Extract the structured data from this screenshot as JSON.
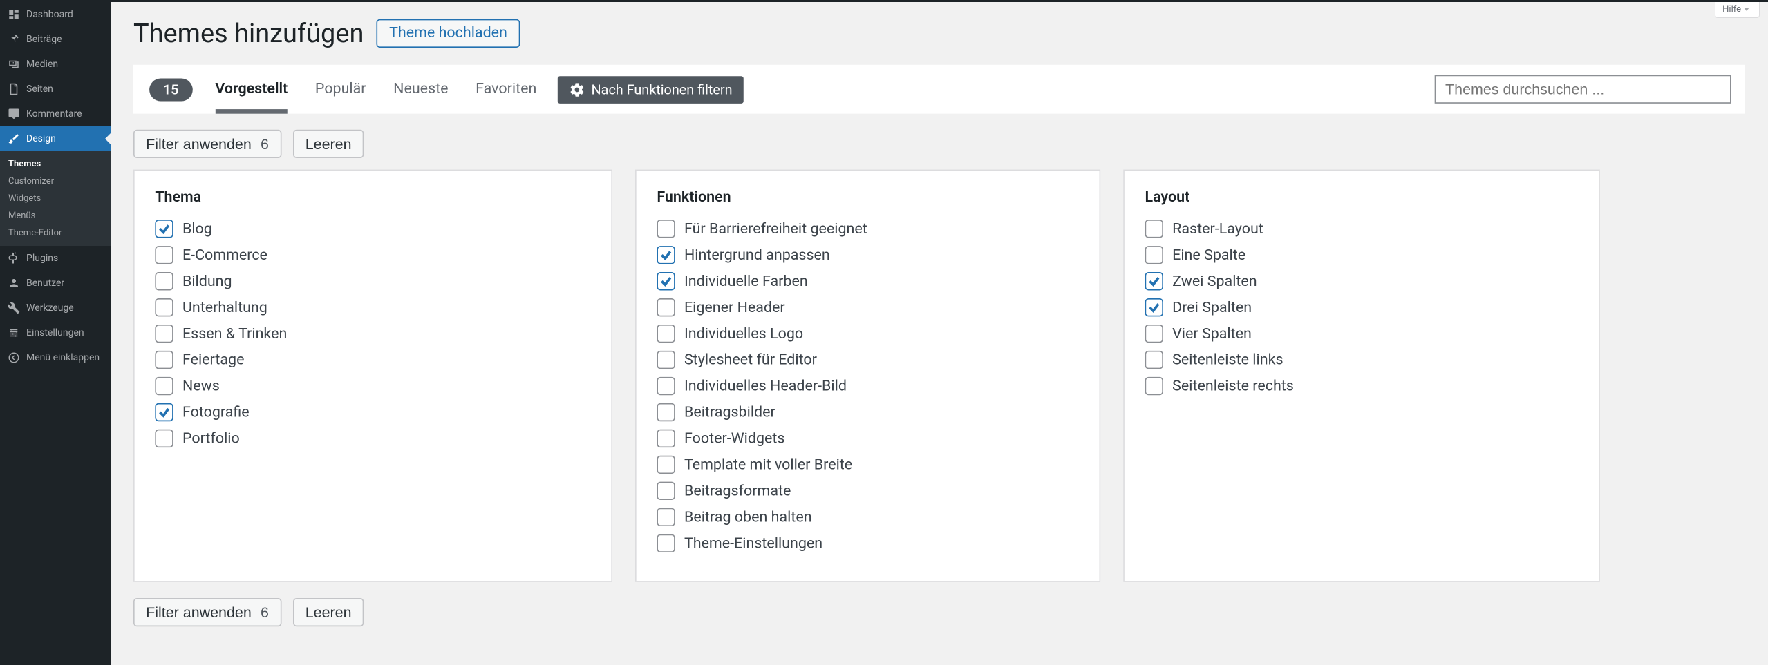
{
  "topHelp": "Hilfe",
  "sidebar": {
    "items": [
      {
        "label": "Dashboard",
        "icon": "dashboard"
      },
      {
        "label": "Beiträge",
        "icon": "pin"
      },
      {
        "label": "Medien",
        "icon": "media"
      },
      {
        "label": "Seiten",
        "icon": "page"
      },
      {
        "label": "Kommentare",
        "icon": "comment"
      },
      {
        "label": "Design",
        "icon": "brush",
        "active": true
      },
      {
        "label": "Plugins",
        "icon": "plugin"
      },
      {
        "label": "Benutzer",
        "icon": "user"
      },
      {
        "label": "Werkzeuge",
        "icon": "tool"
      },
      {
        "label": "Einstellungen",
        "icon": "settings"
      },
      {
        "label": "Menü einklappen",
        "icon": "collapse"
      }
    ],
    "submenu": [
      {
        "label": "Themes",
        "current": true
      },
      {
        "label": "Customizer"
      },
      {
        "label": "Widgets"
      },
      {
        "label": "Menüs"
      },
      {
        "label": "Theme-Editor"
      }
    ]
  },
  "page": {
    "title": "Themes hinzufügen",
    "upload": "Theme hochladen"
  },
  "filterBar": {
    "count": "15",
    "tabs": [
      {
        "label": "Vorgestellt",
        "current": false,
        "bold": true
      },
      {
        "label": "Populär"
      },
      {
        "label": "Neueste"
      },
      {
        "label": "Favoriten"
      }
    ],
    "featureFilter": "Nach Funktionen filtern",
    "searchPlaceholder": "Themes durchsuchen ..."
  },
  "actions": {
    "apply": "Filter anwenden",
    "applyCount": "6",
    "clear": "Leeren"
  },
  "groups": [
    {
      "title": "Thema",
      "items": [
        {
          "label": "Blog",
          "checked": true
        },
        {
          "label": "E-Commerce"
        },
        {
          "label": "Bildung"
        },
        {
          "label": "Unterhaltung"
        },
        {
          "label": "Essen & Trinken"
        },
        {
          "label": "Feiertage"
        },
        {
          "label": "News"
        },
        {
          "label": "Fotografie",
          "checked": true
        },
        {
          "label": "Portfolio"
        }
      ]
    },
    {
      "title": "Funktionen",
      "items": [
        {
          "label": "Für Barrierefreiheit geeignet"
        },
        {
          "label": "Hintergrund anpassen",
          "checked": true
        },
        {
          "label": "Individuelle Farben",
          "checked": true
        },
        {
          "label": "Eigener Header"
        },
        {
          "label": "Individuelles Logo"
        },
        {
          "label": "Stylesheet für Editor"
        },
        {
          "label": "Individuelles Header-Bild"
        },
        {
          "label": "Beitragsbilder"
        },
        {
          "label": "Footer-Widgets"
        },
        {
          "label": "Template mit voller Breite"
        },
        {
          "label": "Beitragsformate"
        },
        {
          "label": "Beitrag oben halten"
        },
        {
          "label": "Theme-Einstellungen"
        }
      ]
    },
    {
      "title": "Layout",
      "items": [
        {
          "label": "Raster-Layout"
        },
        {
          "label": "Eine Spalte"
        },
        {
          "label": "Zwei Spalten",
          "checked": true
        },
        {
          "label": "Drei Spalten",
          "checked": true
        },
        {
          "label": "Vier Spalten"
        },
        {
          "label": "Seitenleiste links"
        },
        {
          "label": "Seitenleiste rechts"
        }
      ]
    }
  ]
}
